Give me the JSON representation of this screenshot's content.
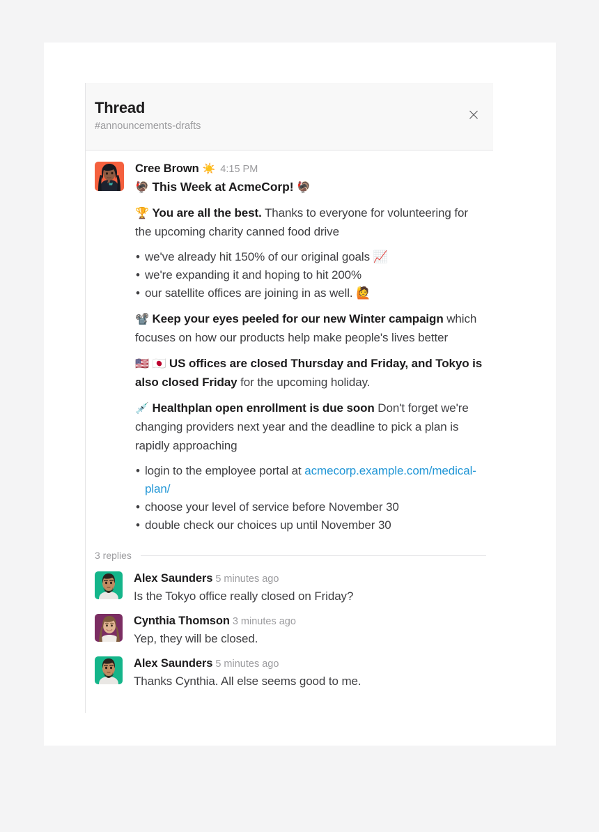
{
  "header": {
    "title": "Thread",
    "channel": "#announcements-drafts",
    "close_label": "×"
  },
  "root_message": {
    "author": "Cree Brown",
    "status_emoji": "☀️",
    "timestamp": "4:15 PM",
    "avatar_color": "#f4603e",
    "blocks": {
      "title_emoji_left": "🦃",
      "title_text": "This Week at AcmeCorp!",
      "title_emoji_right": "🦃",
      "para1_emoji": "🏆",
      "para1_bold": "You are all the best.",
      "para1_rest": " Thanks to everyone for volunteering for the upcoming charity canned food drive",
      "bullets1": [
        "we've already hit 150% of our original goals 📈",
        "we're expanding it and hoping to hit 200%",
        "our satellite offices are joining in as well. 🙋"
      ],
      "para2_emoji": "📽️",
      "para2_bold": "Keep your eyes peeled for our new Winter campaign",
      "para2_rest": " which focuses on how our products help make people's lives better",
      "para3_emoji_us": "🇺🇸",
      "para3_emoji_jp": "🇯🇵",
      "para3_bold": "US offices are closed Thursday and Friday, and Tokyo is also closed Friday",
      "para3_rest": " for the upcoming holiday.",
      "para4_emoji": "💉",
      "para4_bold": "Healthplan open enrollment is due soon",
      "para4_rest": " Don't forget we're changing providers next year and the deadline to pick a plan is rapidly approaching",
      "bullet2_prefix": "login to the employee portal at ",
      "bullet2_link": "acmecorp.example.com/medical-plan/",
      "bullet2_b": "choose your level of service before November 30",
      "bullet2_c": "double check our choices up until November 30"
    }
  },
  "replies_divider": {
    "count_label": "3 replies"
  },
  "replies": [
    {
      "author": "Alex Saunders",
      "timestamp": "5 minutes ago",
      "text": "Is the Tokyo office really closed on Friday?",
      "avatar_color": "#14b58a"
    },
    {
      "author": "Cynthia Thomson",
      "timestamp": "3 minutes ago",
      "text": "Yep, they will be closed.",
      "avatar_color": "#7b2d62"
    },
    {
      "author": "Alex Saunders",
      "timestamp": "5 minutes ago",
      "text": "Thanks Cynthia. All else seems good to me.",
      "avatar_color": "#14b58a"
    }
  ],
  "colors": {
    "page_background": "#f4f4f5",
    "card_background": "#ffffff",
    "header_background": "#f8f8f8",
    "border": "#e4e4e6",
    "text_primary": "#1d1c1d",
    "text_body": "#3f3f42",
    "text_muted": "#9b9b9e",
    "link": "#2196d6"
  }
}
